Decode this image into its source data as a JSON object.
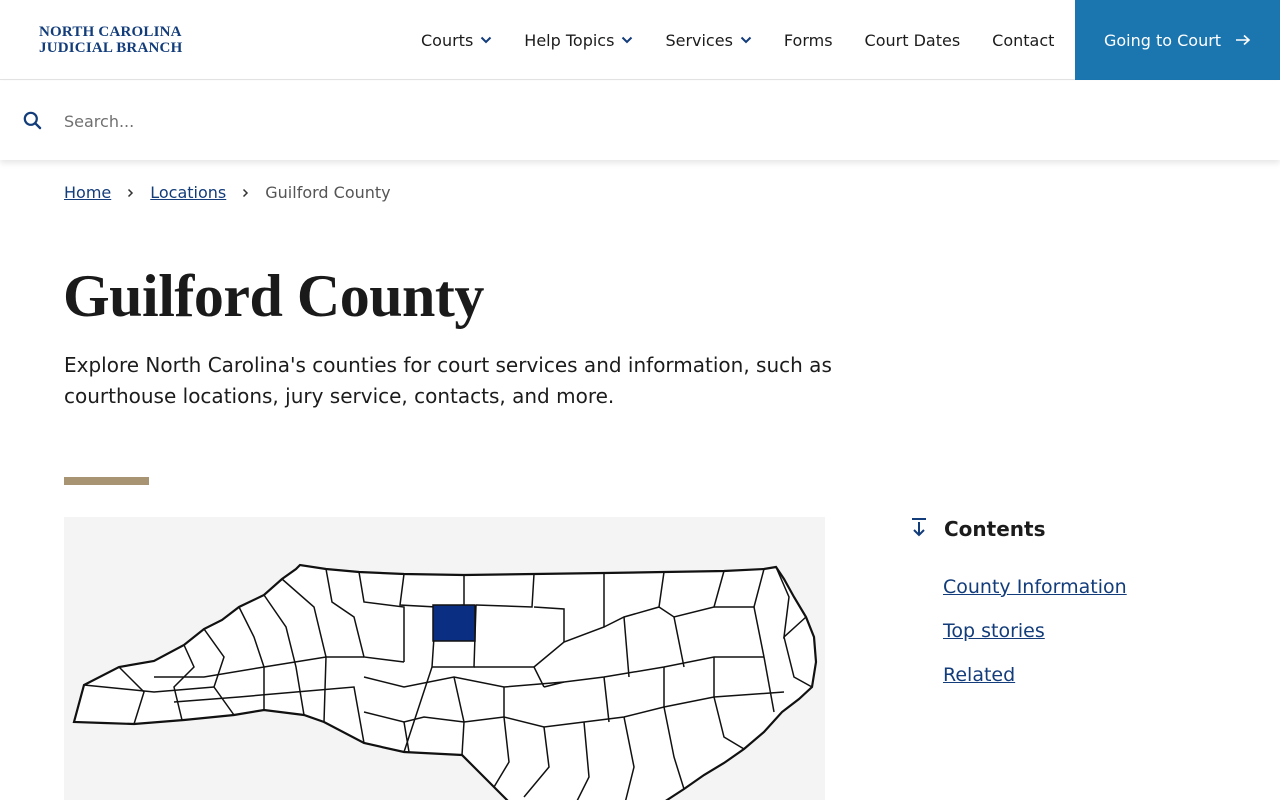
{
  "header": {
    "logo_line1": "NORTH CAROLINA",
    "logo_line2": "JUDICIAL BRANCH",
    "nav": [
      {
        "label": "Courts",
        "dropdown": true
      },
      {
        "label": "Help Topics",
        "dropdown": true
      },
      {
        "label": "Services",
        "dropdown": true
      },
      {
        "label": "Forms",
        "dropdown": false
      },
      {
        "label": "Court Dates",
        "dropdown": false
      },
      {
        "label": "Contact",
        "dropdown": false
      }
    ],
    "cta_label": "Going to Court"
  },
  "search": {
    "placeholder": "Search...",
    "value": ""
  },
  "breadcrumb": {
    "home": "Home",
    "locations": "Locations",
    "current": "Guilford County"
  },
  "page": {
    "title": "Guilford County",
    "intro": "Explore North Carolina's counties for court services and information, such as courthouse locations, jury service, contacts, and more."
  },
  "contents": {
    "title": "Contents",
    "items": [
      "County Information",
      "Top stories",
      "Related"
    ]
  },
  "colors": {
    "brand_blue": "#123c7a",
    "cta_blue": "#1b76b0",
    "accent_tan": "#a89472",
    "highlight_county": "#0a2e82"
  }
}
